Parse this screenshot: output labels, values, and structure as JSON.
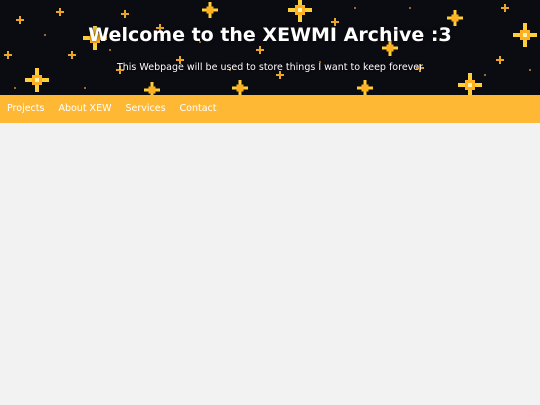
{
  "header": {
    "title": "Welcome to the XEWMI Archive :3",
    "subtitle": "This Webpage will be used to store things I want to keep forever",
    "background_icon": "sparkle-star-pattern",
    "star_color": "#ffc21f",
    "background_color": "#0b0b12"
  },
  "nav": {
    "background_color": "#ffb834",
    "items": [
      {
        "label": "Projects"
      },
      {
        "label": "About XEW"
      },
      {
        "label": "Services"
      },
      {
        "label": "Contact"
      }
    ]
  },
  "main": {
    "background_color": "#f2f2f2"
  }
}
